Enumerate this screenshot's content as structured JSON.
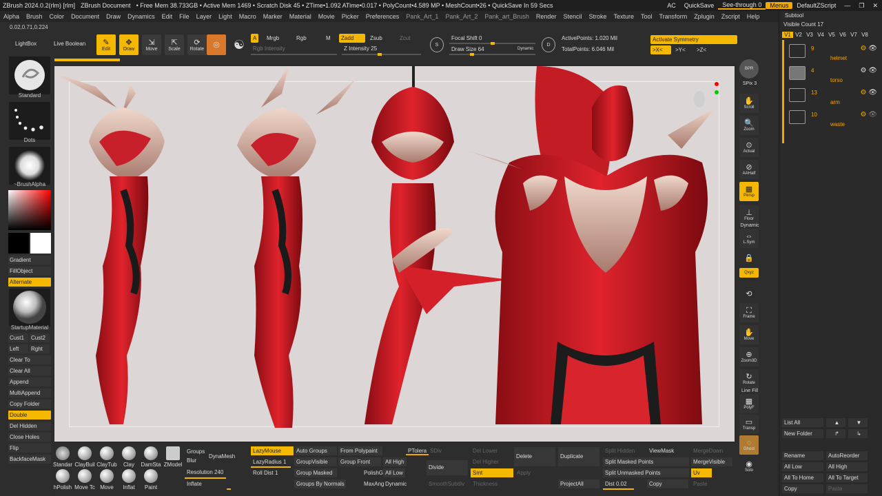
{
  "titlebar": {
    "items": [
      "ZBrush 2024.0.2(rlm) [rlm]",
      "ZBrush Document",
      "• Free Mem 38.733GB • Active Mem 1469 • Scratch Disk 45 • ZTime•1.092 ATime•0.017 • PolyCount•4.589 MP • MeshCount•26 • QuickSave In 59 Secs"
    ],
    "right": {
      "ac": "AC",
      "quicksave": "QuickSave",
      "seethrough": "See-through  0",
      "menus": "Menus",
      "script": "DefaultZScript"
    }
  },
  "menubar": [
    "Alpha",
    "Brush",
    "Color",
    "Document",
    "Draw",
    "Dynamics",
    "Edit",
    "File",
    "Layer",
    "Light",
    "Macro",
    "Marker",
    "Material",
    "Movie",
    "Picker",
    "Preferences",
    "Pank_Art_1",
    "Pank_Art_2",
    "Pank_art_Brush",
    "Render",
    "Stencil",
    "Stroke",
    "Texture",
    "Tool",
    "Transform",
    "Zplugin",
    "Zscript",
    "Help"
  ],
  "shelf": {
    "coords": "0.02,0.71,0.224",
    "lightbox": "LightBox",
    "liveboolean": "Live Boolean",
    "tools": [
      {
        "label": "Edit",
        "icon": "edit-icon",
        "active": true
      },
      {
        "label": "Draw",
        "icon": "draw-icon",
        "active": true
      },
      {
        "label": "Move",
        "icon": "move-icon",
        "active": false
      },
      {
        "label": "Scale",
        "icon": "scale-icon",
        "active": false
      },
      {
        "label": "Rotate",
        "icon": "rotate-icon",
        "active": false
      }
    ],
    "a": "A",
    "mrgb": "Mrgb",
    "rgb": "Rgb",
    "m": "M",
    "rgb_intensity": "Rgb Intensity",
    "zadd": "Zadd",
    "zsub": "Zsub",
    "zcut": "Zcut",
    "z_intensity": "Z Intensity 25",
    "focal_shift": "Focal Shift 0",
    "draw_size": "Draw Size 64",
    "dynamic": "Dynamic",
    "active_points": "ActivePoints: 1.020 Mil",
    "total_points": "TotalPoints: 6.046 Mil",
    "activate_symmetry": "Activate Symmetry",
    "sx": ">X<",
    "sy": ">Y<",
    "sz": ">Z<"
  },
  "left": {
    "standard": "Standard",
    "dots": "Dots",
    "brushalpha": "~BrushAlpha",
    "gradient": "Gradient",
    "fillobject": "FillObject",
    "alternate": "Alternate",
    "startupmaterial": "StartupMaterial",
    "buttons": [
      "Cust1",
      "Cust2",
      "Left",
      "Rght",
      "Clear To",
      "Clear All",
      "Append",
      "MultiAppend",
      "Copy Folder",
      "Double",
      "Del Hidden",
      "Close Holes",
      "Flip",
      "BackfaceMask"
    ]
  },
  "rightstrip": {
    "bpr": "BPR",
    "spix": "SPix 3",
    "items": [
      "Scroll",
      "Zoom",
      "Actual",
      "AAHalf",
      "Persp",
      "Floor",
      "L.Sym",
      "Qxyz",
      "Frame",
      "Move",
      "Zoom3D",
      "Rotate",
      "PolyF",
      "Transp",
      "Ghost",
      "Solo"
    ],
    "dynamic": "Dynamic",
    "linefill": "Line Fill"
  },
  "subtool": {
    "title": "Subtool",
    "visible_count": "Visible Count 17",
    "versions": [
      "V1",
      "V2",
      "V3",
      "V4",
      "V5",
      "V6",
      "V7",
      "V8"
    ],
    "items": [
      {
        "count": "9",
        "name": "helmet"
      },
      {
        "count": "4",
        "name": "torso"
      },
      {
        "count": "13",
        "name": "arm"
      },
      {
        "count": "10",
        "name": "waste"
      }
    ],
    "buttons": [
      "List All",
      "New Folder",
      "Rename",
      "AutoReorder",
      "All Low",
      "All High",
      "All To Home",
      "All To Target",
      "Copy",
      "Paste"
    ]
  },
  "bottom": {
    "brushes_row1": [
      "Standar",
      "ClayBuil",
      "ClayTub",
      "Clay",
      "DamSta",
      "ZModel"
    ],
    "brushes_row2": [
      "hPolish",
      "Move Tc",
      "Move",
      "Inflat",
      "Paint"
    ],
    "groups": "Groups",
    "blur": "Blur",
    "dynamesh": "DynaMesh",
    "resolution": "Resolution 240",
    "inflate": "Inflate",
    "lazymouse": "LazyMouse",
    "lazyradius": "LazyRadius 1",
    "rolldist": "Roll Dist 1",
    "autogroups": "Auto Groups",
    "groupvisible": "GroupVisible",
    "groupmasked": "Group Masked",
    "groupsbynormals": "Groups By Normals",
    "frompolypaint": "From Polypaint",
    "groupfront": "Group Front",
    "polishg": "PolishG",
    "maxang": "MaxAng",
    "allhigh": "All High",
    "alllow": "All Low",
    "dynamic": "Dynamic",
    "ptolera": "PTolera",
    "sdiv": "SDiv",
    "divide": "Divide",
    "smoothsubdiv": "SmoothSubdiv",
    "dellower": "Del Lower",
    "delhigher": "Del Higher",
    "smt": "Smt",
    "apply": "Apply",
    "thickness": "Thickness",
    "delete": "Delete",
    "duplicate": "Duplicate",
    "projectall": "ProjectAll",
    "splithidden": "Split Hidden",
    "viewmask": "ViewMask",
    "splitmasked": "Split Masked Points",
    "splitunmasked": "Split Unmasked Points",
    "dist": "Dist 0.02",
    "copy": "Copy",
    "mergedown": "MergeDown",
    "mergevisible": "MergeVisible",
    "uv": "Uv",
    "paste": "Paste"
  }
}
